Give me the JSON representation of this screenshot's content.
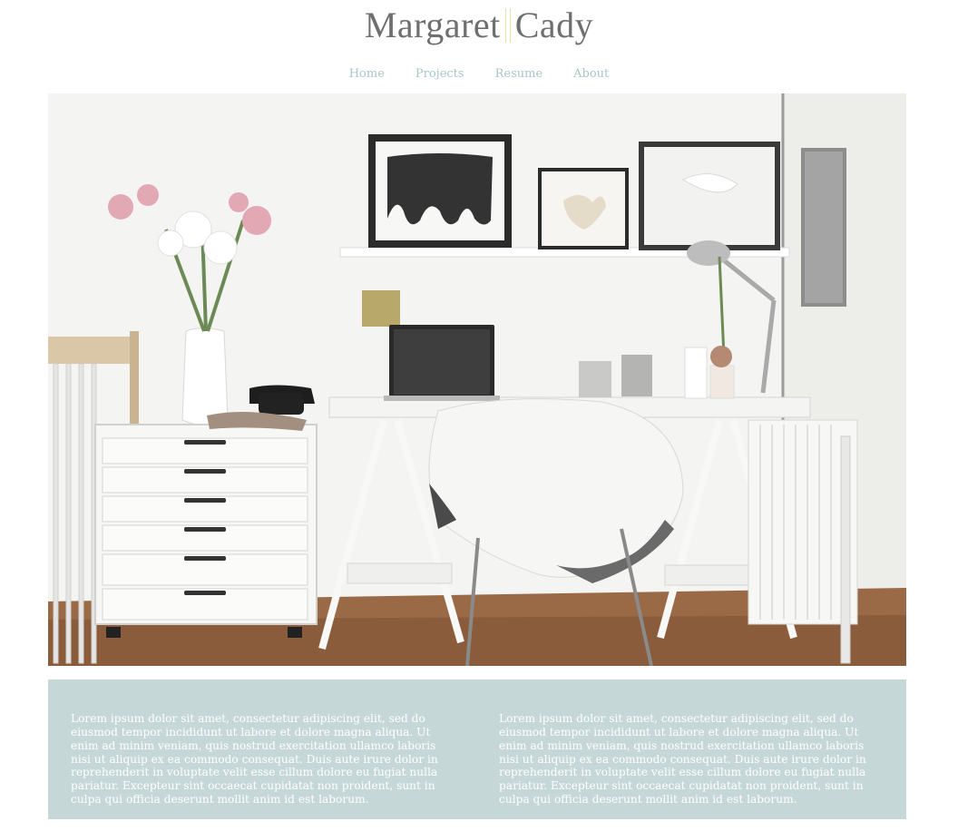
{
  "site": {
    "logo_first": "Margaret",
    "logo_last": "Cady"
  },
  "nav": {
    "items": [
      {
        "label": "Home"
      },
      {
        "label": "Projects"
      },
      {
        "label": "Resume"
      },
      {
        "label": "About"
      }
    ]
  },
  "content": {
    "columns": [
      {
        "text": "Lorem ipsum dolor sit amet, consectetur adipiscing elit, sed do eiusmod tempor incididunt ut labore et dolore magna aliqua. Ut enim ad minim veniam, quis nostrud exercitation ullamco laboris nisi ut aliquip ex ea commodo consequat. Duis aute irure dolor in reprehenderit in voluptate velit esse cillum dolore eu fugiat nulla pariatur. Excepteur sint occaecat cupidatat non proident, sunt in culpa qui officia deserunt mollit anim id est laborum."
      },
      {
        "text": "Lorem ipsum dolor sit amet, consectetur adipiscing elit, sed do eiusmod tempor incididunt ut labore et dolore magna aliqua. Ut enim ad minim veniam, quis nostrud exercitation ullamco laboris nisi ut aliquip ex ea commodo consequat. Duis aute irure dolor in reprehenderit in voluptate velit esse cillum dolore eu fugiat nulla pariatur. Excepteur sint occaecat cupidatat non proident, sunt in culpa qui officia deserunt mollit anim id est laborum."
      }
    ]
  },
  "colors": {
    "logo": "#6f6f6f",
    "nav_link": "#a8c6c7",
    "info_panel": "#c5d8d7",
    "info_text": "#ffffff"
  }
}
